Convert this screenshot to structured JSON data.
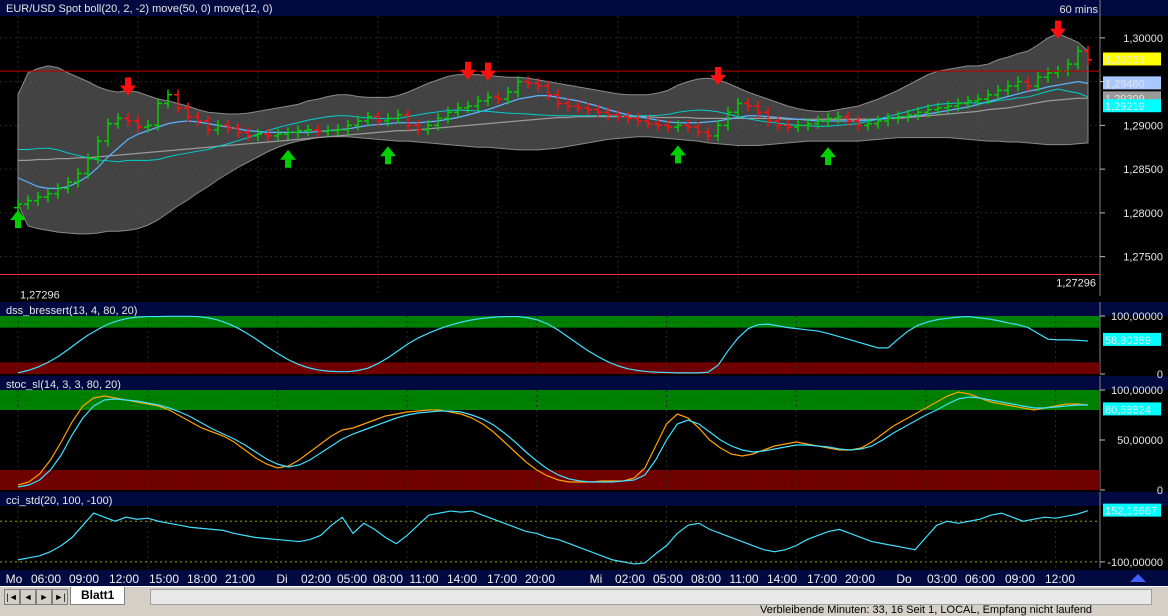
{
  "timeframe": "60 mins",
  "chart_data": [
    {
      "type": "candlestick",
      "title": "EUR/USD Spot  boll(20, 2, -2)  move(50, 0)  move(12, 0)",
      "ylim": [
        1.2705,
        1.3025
      ],
      "yticks": [
        1.3,
        1.295,
        1.29,
        1.285,
        1.28,
        1.275
      ],
      "ytick_labels": [
        "1,30000",
        "",
        "1,29000",
        "1,28500",
        "1,28000",
        "1,27500"
      ],
      "value_labels": [
        {
          "label": "1,29753",
          "value": 1.29753,
          "bg": "#ffff00",
          "fg": "#000000"
        },
        {
          "label": "1,29480",
          "value": 1.2948,
          "bg": "#a8c8ff",
          "fg": "#000000"
        },
        {
          "label": "1,29309",
          "value": 1.29309,
          "bg": "#9a9a9a",
          "fg": "#000000"
        },
        {
          "label": "1,29219",
          "value": 1.29219,
          "bg": "#00ffff",
          "fg": "#000000"
        }
      ],
      "hlines": [
        {
          "value": 1.2962,
          "label": "",
          "color": "#c00000"
        },
        {
          "value": 1.27296,
          "label": "1,27296",
          "color": "#ff3030"
        }
      ],
      "close": [
        1.281,
        1.2814,
        1.2818,
        1.2822,
        1.2828,
        1.2835,
        1.2845,
        1.2862,
        1.2882,
        1.2902,
        1.2908,
        1.2905,
        1.2898,
        1.29,
        1.2925,
        1.2935,
        1.292,
        1.291,
        1.2905,
        1.2895,
        1.29,
        1.2897,
        1.2892,
        1.2888,
        1.289,
        1.2888,
        1.289,
        1.2892,
        1.2894,
        1.2895,
        1.2893,
        1.2894,
        1.2895,
        1.29,
        1.2905,
        1.291,
        1.2905,
        1.2908,
        1.2912,
        1.29,
        1.2895,
        1.29,
        1.2908,
        1.2915,
        1.292,
        1.2922,
        1.2928,
        1.2932,
        1.293,
        1.2938,
        1.295,
        1.2948,
        1.2945,
        1.2935,
        1.2925,
        1.2922,
        1.292,
        1.2918,
        1.2915,
        1.2912,
        1.291,
        1.2908,
        1.2905,
        1.2902,
        1.29,
        1.2898,
        1.29,
        1.2898,
        1.2892,
        1.2888,
        1.29,
        1.2915,
        1.2925,
        1.2922,
        1.2915,
        1.2905,
        1.29,
        1.2898,
        1.29,
        1.2902,
        1.2905,
        1.2908,
        1.291,
        1.2905,
        1.29,
        1.2902,
        1.2905,
        1.2908,
        1.291,
        1.2912,
        1.2915,
        1.2918,
        1.292,
        1.2922,
        1.2925,
        1.2928,
        1.293,
        1.2935,
        1.294,
        1.2945,
        1.295,
        1.2945,
        1.2955,
        1.296,
        1.2962,
        1.297,
        1.2985,
        1.2975
      ],
      "boll_upper": [
        1.2935,
        1.296,
        1.2965,
        1.2968,
        1.2966,
        1.296,
        1.2955,
        1.295,
        1.2944,
        1.294,
        1.2938,
        1.294,
        1.2938,
        1.2934,
        1.293,
        1.2928,
        1.2925,
        1.2922,
        1.2918,
        1.2915,
        1.2914,
        1.2913,
        1.2913,
        1.2914,
        1.2916,
        1.2918,
        1.292,
        1.2922,
        1.2924,
        1.2928,
        1.293,
        1.2933,
        1.2935,
        1.2935,
        1.2933,
        1.2932,
        1.2932,
        1.2932,
        1.2934,
        1.2938,
        1.2943,
        1.2948,
        1.2952,
        1.2956,
        1.2958,
        1.2958,
        1.2958,
        1.2957,
        1.2956,
        1.2955,
        1.2955,
        1.2954,
        1.2952,
        1.295,
        1.2948,
        1.2946,
        1.2944,
        1.2942,
        1.294,
        1.2938,
        1.2936,
        1.2935,
        1.2935,
        1.2935,
        1.2937,
        1.294,
        1.2946,
        1.295,
        1.2953,
        1.2954,
        1.2952,
        1.2948,
        1.2943,
        1.2938,
        1.2934,
        1.293,
        1.2926,
        1.2922,
        1.2919,
        1.2917,
        1.2916,
        1.2916,
        1.2918,
        1.292,
        1.2922,
        1.2926,
        1.293,
        1.2935,
        1.294,
        1.2946,
        1.2952,
        1.2958,
        1.2962,
        1.2964,
        1.2966,
        1.2968,
        1.2968,
        1.297,
        1.2975,
        1.2978,
        1.2982,
        1.2985,
        1.2992,
        1.3,
        1.3005,
        1.3,
        1.2995,
        1.2985
      ],
      "boll_lower": [
        1.281,
        1.2785,
        1.2782,
        1.278,
        1.2778,
        1.2777,
        1.2776,
        1.2776,
        1.2777,
        1.2779,
        1.2779,
        1.278,
        1.2782,
        1.2786,
        1.2792,
        1.28,
        1.2808,
        1.2815,
        1.2823,
        1.283,
        1.2838,
        1.2845,
        1.2852,
        1.2858,
        1.2864,
        1.287,
        1.2875,
        1.2879,
        1.2882,
        1.2884,
        1.2886,
        1.2887,
        1.2887,
        1.2887,
        1.2886,
        1.2885,
        1.2884,
        1.2883,
        1.2882,
        1.2882,
        1.2881,
        1.288,
        1.2879,
        1.2878,
        1.2877,
        1.2876,
        1.2875,
        1.2875,
        1.2874,
        1.2873,
        1.2872,
        1.2872,
        1.2872,
        1.2873,
        1.2874,
        1.2876,
        1.2878,
        1.288,
        1.2882,
        1.2884,
        1.2885,
        1.2886,
        1.2887,
        1.2887,
        1.2886,
        1.2885,
        1.2884,
        1.2883,
        1.2882,
        1.288,
        1.2879,
        1.2878,
        1.2877,
        1.2877,
        1.2877,
        1.2878,
        1.2879,
        1.288,
        1.2881,
        1.2882,
        1.2882,
        1.2882,
        1.2882,
        1.2882,
        1.2882,
        1.2883,
        1.2884,
        1.2885,
        1.2886,
        1.2886,
        1.2886,
        1.2886,
        1.2886,
        1.2886,
        1.2885,
        1.2884,
        1.2883,
        1.2882,
        1.2882,
        1.2881,
        1.2881,
        1.288,
        1.2879,
        1.2878,
        1.2878,
        1.2878,
        1.2879,
        1.288
      ],
      "sma50": [
        1.286,
        1.286,
        1.2861,
        1.2861,
        1.2862,
        1.2862,
        1.2863,
        1.2863,
        1.2864,
        1.2865,
        1.2866,
        1.2867,
        1.2868,
        1.2869,
        1.287,
        1.2871,
        1.2872,
        1.2873,
        1.2874,
        1.2875,
        1.2876,
        1.2877,
        1.2878,
        1.2879,
        1.288,
        1.2881,
        1.2882,
        1.2883,
        1.2884,
        1.2885,
        1.2886,
        1.2887,
        1.2888,
        1.2889,
        1.289,
        1.2891,
        1.2892,
        1.2893,
        1.2894,
        1.2894,
        1.2895,
        1.2896,
        1.2897,
        1.2898,
        1.2899,
        1.29,
        1.2901,
        1.2902,
        1.2903,
        1.2904,
        1.2905,
        1.2906,
        1.2907,
        1.2908,
        1.2909,
        1.2909,
        1.291,
        1.291,
        1.291,
        1.291,
        1.291,
        1.291,
        1.291,
        1.291,
        1.2909,
        1.2909,
        1.2909,
        1.2909,
        1.2908,
        1.2908,
        1.2908,
        1.2908,
        1.2908,
        1.2908,
        1.2908,
        1.2908,
        1.2908,
        1.2907,
        1.2907,
        1.2907,
        1.2907,
        1.2907,
        1.2907,
        1.2907,
        1.2907,
        1.2907,
        1.2907,
        1.2908,
        1.2908,
        1.2909,
        1.291,
        1.2911,
        1.2912,
        1.2913,
        1.2914,
        1.2915,
        1.2916,
        1.2918,
        1.2919,
        1.292,
        1.2922,
        1.2924,
        1.2926,
        1.2928,
        1.2929,
        1.293,
        1.2931,
        1.2931
      ],
      "sma12": [
        1.284,
        1.2835,
        1.283,
        1.2828,
        1.2828,
        1.283,
        1.2835,
        1.2842,
        1.2852,
        1.2864,
        1.2874,
        1.2884,
        1.289,
        1.2894,
        1.2898,
        1.2902,
        1.2904,
        1.2905,
        1.2904,
        1.2902,
        1.29,
        1.2898,
        1.2896,
        1.2894,
        1.2893,
        1.2892,
        1.2892,
        1.2892,
        1.2892,
        1.2892,
        1.2893,
        1.2894,
        1.2895,
        1.2896,
        1.2898,
        1.29,
        1.2901,
        1.2902,
        1.2903,
        1.2903,
        1.2903,
        1.2904,
        1.2905,
        1.2907,
        1.2909,
        1.2912,
        1.2915,
        1.2918,
        1.2922,
        1.2926,
        1.293,
        1.2932,
        1.2934,
        1.2934,
        1.2932,
        1.293,
        1.2928,
        1.2925,
        1.2922,
        1.2918,
        1.2915,
        1.2912,
        1.291,
        1.2908,
        1.2906,
        1.2904,
        1.2903,
        1.2903,
        1.2903,
        1.2904,
        1.2905,
        1.2907,
        1.2909,
        1.2911,
        1.2911,
        1.291,
        1.2909,
        1.2908,
        1.2907,
        1.2906,
        1.2905,
        1.2905,
        1.2905,
        1.2905,
        1.2905,
        1.2906,
        1.2907,
        1.2908,
        1.2909,
        1.291,
        1.2911,
        1.2913,
        1.2915,
        1.2917,
        1.2919,
        1.2921,
        1.2924,
        1.2927,
        1.293,
        1.2933,
        1.2936,
        1.2939,
        1.2941,
        1.2944,
        1.2946,
        1.2948,
        1.295,
        1.2948
      ],
      "up_arrows": [
        0,
        27,
        37,
        66,
        81
      ],
      "down_arrows": [
        11,
        45,
        47,
        70,
        104
      ]
    },
    {
      "type": "line",
      "title": "dss_bressert(13, 4, 80, 20)",
      "ylim": [
        0,
        100
      ],
      "yticks": [
        100,
        0
      ],
      "ytick_labels": [
        "100,00000",
        "0"
      ],
      "bands": [
        {
          "from": 80,
          "to": 100,
          "color": "#00a000"
        },
        {
          "from": 0,
          "to": 20,
          "color": "#8c0000"
        }
      ],
      "value_labels": [
        {
          "label": "58,80389",
          "value": 58.8,
          "bg": "#00ffff",
          "fg": "#000000"
        }
      ],
      "series": [
        {
          "name": "",
          "color": "#40e0ff",
          "values": [
            2,
            6,
            12,
            20,
            30,
            42,
            55,
            67,
            77,
            86,
            92,
            96,
            98,
            99,
            99,
            99.5,
            99.5,
            99.5,
            99,
            97,
            93,
            87,
            79,
            69,
            58,
            46,
            35,
            25,
            17,
            11,
            7,
            5,
            4,
            4,
            6,
            10,
            18,
            28,
            40,
            52,
            62,
            70,
            77,
            83,
            88,
            92,
            95,
            97,
            98.5,
            99,
            99,
            97,
            93,
            86,
            76,
            64,
            52,
            40,
            30,
            21,
            14,
            9,
            6,
            4,
            3,
            2.5,
            2,
            2,
            2,
            3,
            15,
            40,
            62,
            78,
            85,
            86,
            83,
            80,
            78,
            76,
            74,
            70,
            65,
            60,
            55,
            50,
            45,
            45,
            60,
            74,
            84,
            90,
            94,
            96,
            98,
            99,
            97,
            95,
            92,
            88,
            85,
            80,
            70,
            60,
            58.8,
            58.8,
            58,
            57
          ]
        }
      ]
    },
    {
      "type": "line",
      "title": "stoc_sl(14, 3, 3, 80, 20)",
      "ylim": [
        0,
        100
      ],
      "yticks": [
        100,
        50,
        0
      ],
      "ytick_labels": [
        "100,00000",
        "50,00000",
        "0"
      ],
      "bands": [
        {
          "from": 80,
          "to": 100,
          "color": "#00a000"
        },
        {
          "from": 0,
          "to": 20,
          "color": "#8c0000"
        }
      ],
      "value_labels": [
        {
          "label": "80,58824",
          "value": 80.6,
          "bg": "#00ffff",
          "fg": "#000000"
        }
      ],
      "series": [
        {
          "name": "",
          "color": "#ffa000",
          "values": [
            5,
            8,
            16,
            30,
            48,
            68,
            84,
            92,
            94,
            92,
            90,
            88,
            86,
            84,
            80,
            74,
            68,
            62,
            58,
            54,
            48,
            40,
            32,
            26,
            22,
            24,
            30,
            38,
            46,
            54,
            60,
            62,
            66,
            70,
            74,
            76,
            78,
            79,
            80,
            80,
            78,
            76,
            72,
            66,
            58,
            48,
            38,
            28,
            20,
            14,
            10,
            8,
            8,
            8,
            9,
            9,
            9,
            12,
            22,
            44,
            66,
            76,
            72,
            62,
            50,
            42,
            36,
            34,
            36,
            40,
            44,
            46,
            48,
            46,
            44,
            42,
            40,
            40,
            42,
            48,
            56,
            64,
            70,
            76,
            82,
            88,
            94,
            98,
            96,
            92,
            88,
            86,
            84,
            82,
            80,
            82,
            84,
            86,
            86,
            85
          ]
        },
        {
          "name": "",
          "color": "#40e0ff",
          "values": [
            3,
            5,
            10,
            20,
            35,
            55,
            72,
            84,
            90,
            91,
            90,
            89,
            87,
            85,
            82,
            78,
            73,
            67,
            61,
            56,
            51,
            45,
            38,
            31,
            26,
            23,
            25,
            30,
            37,
            44,
            51,
            56,
            60,
            64,
            68,
            72,
            75,
            77,
            78,
            79,
            79,
            78,
            75,
            71,
            65,
            57,
            48,
            38,
            29,
            21,
            15,
            11,
            9,
            8,
            8,
            8,
            9,
            10,
            15,
            30,
            50,
            66,
            70,
            66,
            58,
            50,
            44,
            40,
            38,
            39,
            41,
            43,
            45,
            45,
            44,
            43,
            41,
            40,
            41,
            44,
            50,
            57,
            63,
            69,
            75,
            80,
            86,
            91,
            93,
            92,
            90,
            88,
            86,
            84,
            82,
            82,
            83,
            84,
            85,
            85
          ]
        }
      ]
    },
    {
      "type": "line",
      "title": "cci_std(20, 100, -100)",
      "ylim": [
        -130,
        175
      ],
      "yticks": [
        -100
      ],
      "ytick_labels": [
        "-100,00000"
      ],
      "hlines": [
        {
          "value": 100,
          "color": "#a0a000"
        },
        {
          "value": -100,
          "color": "#a0a000"
        }
      ],
      "value_labels": [
        {
          "label": "152,15667",
          "value": 152.16,
          "bg": "#00ffff",
          "fg": "#000000"
        }
      ],
      "series": [
        {
          "name": "",
          "color": "#40e0ff",
          "values": [
            -90,
            -80,
            -70,
            -50,
            -20,
            20,
            80,
            140,
            120,
            100,
            120,
            110,
            115,
            100,
            90,
            80,
            70,
            65,
            60,
            55,
            40,
            30,
            20,
            15,
            10,
            5,
            0,
            10,
            30,
            80,
            120,
            40,
            90,
            60,
            20,
            -10,
            30,
            80,
            130,
            140,
            150,
            145,
            150,
            130,
            110,
            90,
            70,
            50,
            40,
            20,
            10,
            -10,
            -30,
            -50,
            -70,
            -90,
            -100,
            -110,
            -105,
            -60,
            -20,
            40,
            80,
            90,
            60,
            40,
            20,
            0,
            -20,
            -40,
            -50,
            -40,
            -20,
            10,
            30,
            50,
            60,
            40,
            20,
            0,
            -10,
            -20,
            -30,
            -40,
            20,
            80,
            100,
            90,
            100,
            110,
            130,
            140,
            120,
            100,
            110,
            120,
            115,
            125,
            135,
            152
          ]
        }
      ]
    }
  ],
  "x_axis": {
    "labels": [
      "Mo",
      "06:00",
      "09:00",
      "12:00",
      "15:00",
      "18:00",
      "21:00",
      "Di",
      "02:00",
      "05:00",
      "08:00",
      "11:00",
      "14:00",
      "17:00",
      "20:00",
      "Mi",
      "02:00",
      "05:00",
      "08:00",
      "11:00",
      "14:00",
      "17:00",
      "20:00",
      "Do",
      "03:00",
      "06:00",
      "09:00",
      "12:00"
    ]
  },
  "statusbar": {
    "sheet_tab": "Blatt1",
    "status_text": "Verbleibende Minuten: 33, 16    Seit 1, LOCAL, Empfang nicht laufend"
  }
}
